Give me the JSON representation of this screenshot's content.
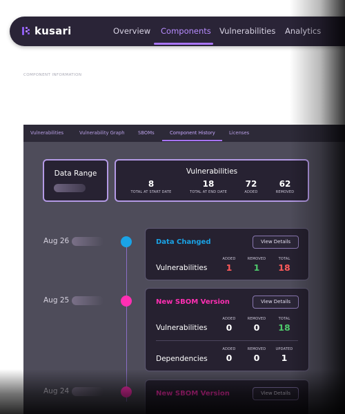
{
  "brand": {
    "name": "kusari"
  },
  "nav": {
    "items": [
      {
        "label": "Overview"
      },
      {
        "label": "Components"
      },
      {
        "label": "Vulnerabilities"
      },
      {
        "label": "Analytics"
      }
    ],
    "active_index": 1
  },
  "section_label": "COMPONENT INFORMATION",
  "tabs": {
    "items": [
      {
        "label": "Vulnerabilities"
      },
      {
        "label": "Vulnerability Graph"
      },
      {
        "label": "SBOMs"
      },
      {
        "label": "Component History"
      },
      {
        "label": "Licenses"
      }
    ],
    "active_index": 3
  },
  "data_range": {
    "title": "Data Range"
  },
  "vulnerabilities_summary": {
    "title": "Vulnerabilities",
    "stats": [
      {
        "value": "8",
        "label": "TOTAL AT START DATE"
      },
      {
        "value": "18",
        "label": "TOTAL AT END DATE"
      },
      {
        "value": "72",
        "label": "ADDED"
      },
      {
        "value": "62",
        "label": "REMOVED"
      }
    ]
  },
  "timeline": [
    {
      "date": "Aug 26",
      "title": "Data Changed",
      "color": "#1aa3e6",
      "button": "View Details",
      "rows": [
        {
          "label": "Vulnerabilities",
          "stats": [
            {
              "label": "ADDED",
              "value": "1",
              "color": "#ff5a5a"
            },
            {
              "label": "REMOVED",
              "value": "1",
              "color": "#4ec86b"
            },
            {
              "label": "TOTAL",
              "value": "18",
              "color": "#ff5a5a"
            }
          ]
        }
      ]
    },
    {
      "date": "Aug 25",
      "title": "New SBOM Version",
      "color": "#ff2fb3",
      "button": "View Details",
      "rows": [
        {
          "label": "Vulnerabilities",
          "stats": [
            {
              "label": "ADDED",
              "value": "0",
              "color": "#ffffff"
            },
            {
              "label": "REMOVED",
              "value": "0",
              "color": "#ffffff"
            },
            {
              "label": "TOTAL",
              "value": "18",
              "color": "#4ec86b"
            }
          ]
        },
        {
          "label": "Dependencies",
          "stats": [
            {
              "label": "ADDED",
              "value": "0",
              "color": "#ffffff"
            },
            {
              "label": "REMOVED",
              "value": "0",
              "color": "#ffffff"
            },
            {
              "label": "UPDATED",
              "value": "1",
              "color": "#ffffff"
            }
          ]
        }
      ]
    },
    {
      "date": "Aug 24",
      "title": "New SBOM Version",
      "color": "#ff2fb3",
      "button": "View Details",
      "rows": []
    }
  ]
}
